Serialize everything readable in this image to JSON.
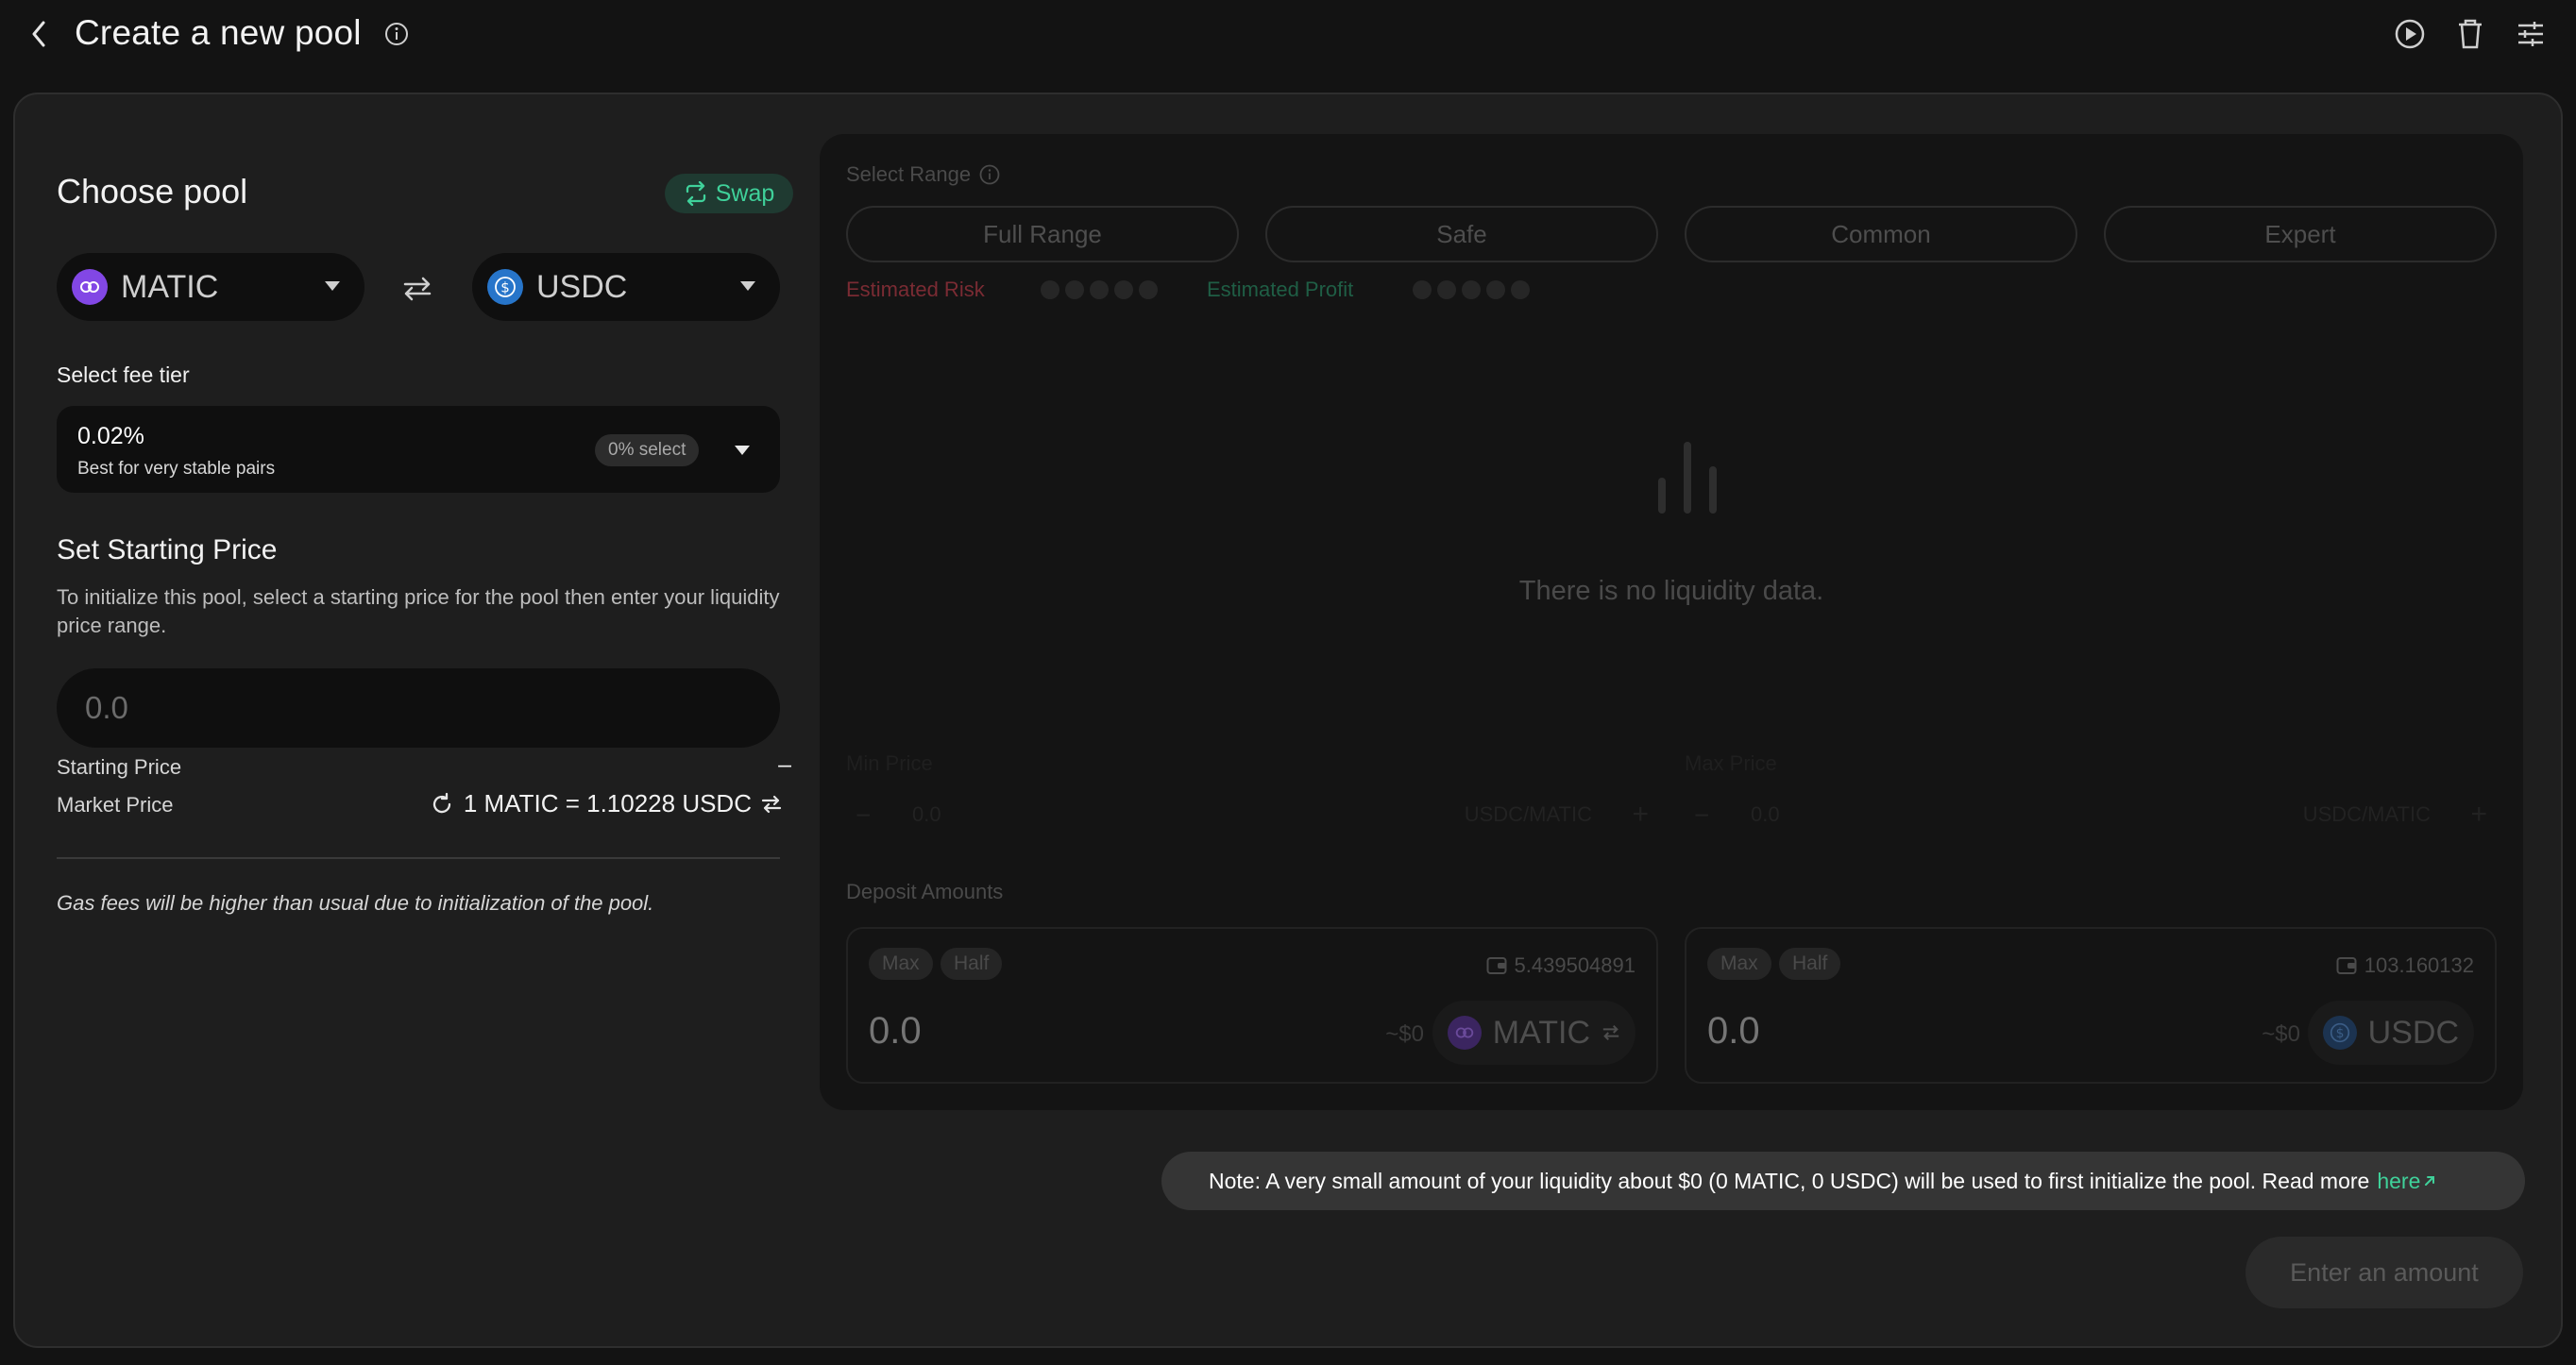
{
  "header": {
    "title": "Create a new pool"
  },
  "choose_pool": {
    "title": "Choose pool",
    "swap_label": "Swap",
    "token_a": {
      "symbol": "MATIC",
      "color": "#8247e5"
    },
    "token_b": {
      "symbol": "USDC",
      "color": "#2775ca"
    }
  },
  "fee_tier": {
    "label": "Select fee tier",
    "value": "0.02%",
    "description": "Best for very stable pairs",
    "badge": "0% select"
  },
  "starting_price": {
    "title": "Set Starting Price",
    "description": "To initialize this pool, select a starting price for the pool then enter your liquidity price range.",
    "input_placeholder": "0.0",
    "starting_label": "Starting Price",
    "starting_value": "–",
    "market_label": "Market Price",
    "market_value": "1 MATIC = 1.10228 USDC",
    "gas_note": "Gas fees will be higher than usual due to initialization of the pool."
  },
  "range": {
    "label": "Select Range",
    "options": [
      "Full Range",
      "Safe",
      "Common",
      "Expert"
    ],
    "risk_label": "Estimated Risk",
    "profit_label": "Estimated Profit",
    "empty_text": "There is no liquidity data.",
    "min_label": "Min Price",
    "max_label": "Max Price",
    "min_value": "0.0",
    "max_value": "0.0",
    "pair_unit": "USDC/MATIC"
  },
  "deposit": {
    "label": "Deposit Amounts",
    "max_label": "Max",
    "half_label": "Half",
    "a": {
      "balance": "5.439504891",
      "amount": "0.0",
      "usd": "~$0",
      "symbol": "MATIC"
    },
    "b": {
      "balance": "103.160132",
      "amount": "0.0",
      "usd": "~$0",
      "symbol": "USDC"
    }
  },
  "note": {
    "text": "Note: A very small amount of your liquidity about $0 (0 MATIC, 0 USDC) will be used to first initialize the pool. Read more",
    "link": "here"
  },
  "cta": "Enter an amount",
  "colors": {
    "accent": "#3fd19a",
    "risk": "#7a2b33",
    "profit": "#1f5e45"
  }
}
